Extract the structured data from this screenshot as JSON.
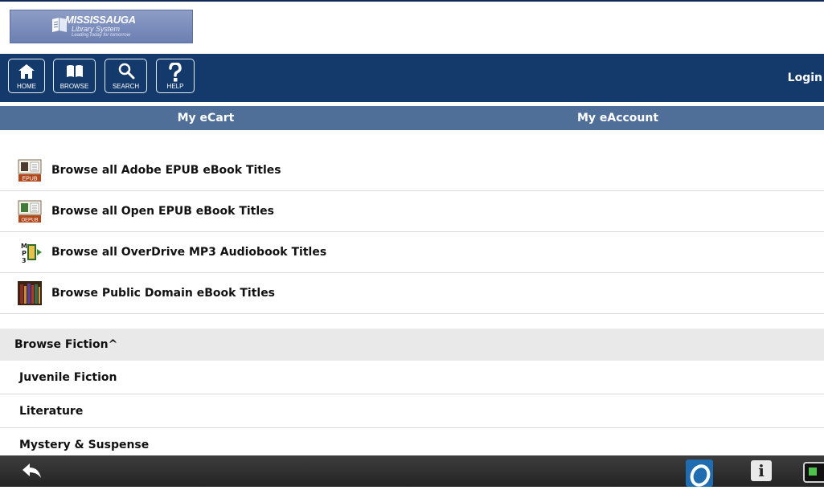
{
  "logo": {
    "title": "MISSISSAUGA",
    "subtitle": "Library System",
    "tagline": "Leading today for tomorrow"
  },
  "toolbar": {
    "buttons": [
      {
        "label": "HOME",
        "icon": "home-icon"
      },
      {
        "label": "BROWSE",
        "icon": "book-icon"
      },
      {
        "label": "SEARCH",
        "icon": "search-icon"
      },
      {
        "label": "HELP",
        "icon": "help-icon"
      }
    ],
    "login": "Login"
  },
  "tabs": [
    {
      "label": "My eCart"
    },
    {
      "label": "My eAccount"
    }
  ],
  "browse": [
    {
      "label": "Browse all Adobe EPUB eBook Titles",
      "icon": "epub-icon",
      "badge": "EPUB"
    },
    {
      "label": "Browse all Open EPUB eBook Titles",
      "icon": "open-epub-icon",
      "badge": "OEPUB"
    },
    {
      "label": "Browse all OverDrive MP3 Audiobook Titles",
      "icon": "mp3-audiobook-icon"
    },
    {
      "label": "Browse Public Domain eBook Titles",
      "icon": "bookshelf-icon"
    }
  ],
  "fiction": {
    "header": "Browse Fiction^",
    "items": [
      "Juvenile Fiction",
      "Literature",
      "Mystery & Suspense"
    ]
  },
  "system_bar": {
    "back_icon": "back-arrow-icon",
    "overdrive_icon": "overdrive-logo-icon",
    "info_label": "i",
    "device_icon": "device-icon"
  },
  "colors": {
    "toolbar": "#143a6b",
    "tabbar": "#4f6f98",
    "section_header": "#e9e9e9",
    "system_bar": "#2e2e2e",
    "epub_badge": "#b3471c"
  }
}
